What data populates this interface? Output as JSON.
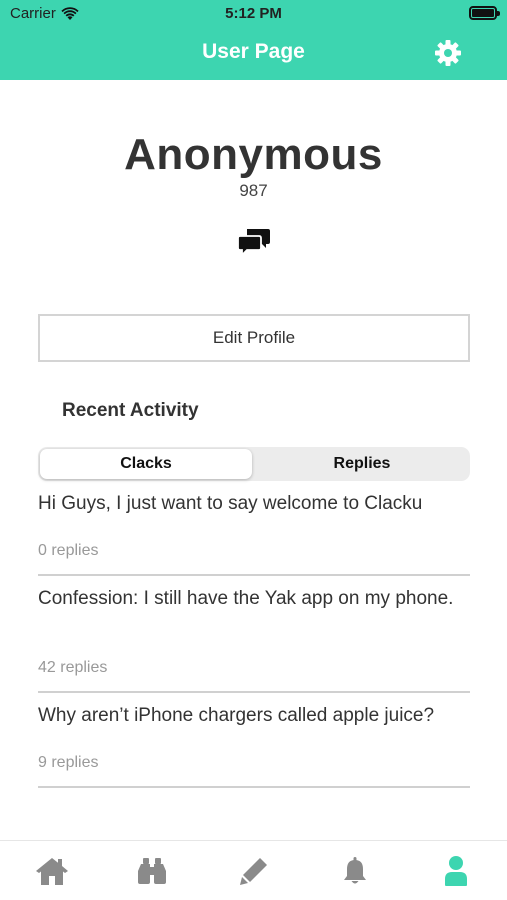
{
  "status_bar": {
    "carrier": "Carrier",
    "time": "5:12 PM"
  },
  "nav": {
    "title": "User Page",
    "settings_icon": "gear-icon"
  },
  "profile": {
    "name": "Anonymous",
    "score": "987",
    "message_icon": "chat-bubbles-icon"
  },
  "edit_button": {
    "label": "Edit Profile"
  },
  "recent_activity": {
    "title": "Recent Activity",
    "tabs": [
      {
        "label": "Clacks",
        "selected": true
      },
      {
        "label": "Replies",
        "selected": false
      }
    ],
    "posts": [
      {
        "text": "Hi Guys, I just want to say welcome to Clacku",
        "replies": "0 replies"
      },
      {
        "text": "Confession: I still have the Yak app on my phone.",
        "replies": "42 replies"
      },
      {
        "text": "Why aren’t iPhone chargers called apple juice?",
        "replies": "9 replies"
      }
    ]
  },
  "tabbar": {
    "items": [
      {
        "name": "home-icon",
        "active": false
      },
      {
        "name": "binoculars-icon",
        "active": false
      },
      {
        "name": "pencil-icon",
        "active": false
      },
      {
        "name": "bell-icon",
        "active": false
      },
      {
        "name": "user-icon",
        "active": true
      }
    ]
  },
  "colors": {
    "accent": "#3dd5b0",
    "text": "#333333",
    "muted": "#999999",
    "inactive_icon": "#8a8a8a"
  }
}
